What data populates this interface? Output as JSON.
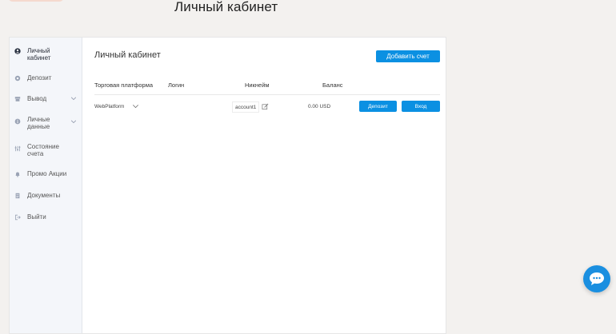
{
  "page": {
    "title": "Личный кабинет"
  },
  "sidebar": {
    "items": [
      {
        "label": "Личный кабинет",
        "icon": "user-icon",
        "active": true
      },
      {
        "label": "Депозит",
        "icon": "wallet-icon"
      },
      {
        "label": "Вывод",
        "icon": "withdraw-icon",
        "expandable": true
      },
      {
        "label": "Личные данные",
        "icon": "info-icon",
        "expandable": true
      },
      {
        "label": "Состояние счета",
        "icon": "sliders-icon"
      },
      {
        "label": "Промо Акции",
        "icon": "bell-icon"
      },
      {
        "label": "Документы",
        "icon": "document-icon"
      },
      {
        "label": "Выйти",
        "icon": "logout-icon"
      }
    ]
  },
  "main": {
    "title": "Личный кабинет",
    "add_account_label": "Добавить счет",
    "table": {
      "headers": [
        "Торговая платформа",
        "Логин",
        "Никнейм",
        "Баланс"
      ],
      "rows": [
        {
          "platform": "WebPlatform",
          "login": "",
          "nickname": "account1",
          "balance": "0.00 USD",
          "deposit_label": "Депозит",
          "login_label": "Вход"
        }
      ]
    }
  },
  "colors": {
    "accent": "#0b90e2",
    "sidebar_bg": "#f4f6fa",
    "page_bg": "#f3f1ef"
  },
  "chat": {
    "icon": "chat-icon"
  }
}
